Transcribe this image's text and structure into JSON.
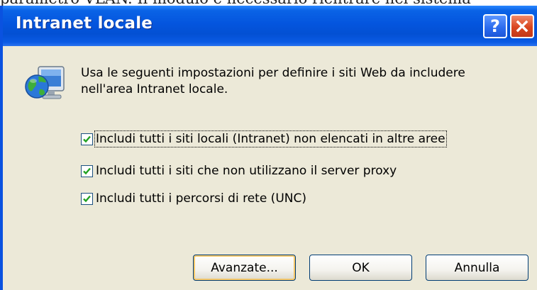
{
  "background_text": "parametro VLAN. Il modulo è necessario rientrare nel sistema",
  "dialog": {
    "title": "Intranet locale",
    "description": "Usa le seguenti impostazioni per definire i siti Web da includere nell'area Intranet locale.",
    "options": [
      {
        "label": "Includi tutti i siti locali (Intranet) non elencati in altre aree",
        "checked": true,
        "focused": true
      },
      {
        "label": "Includi tutti i siti che non utilizzano il server proxy",
        "checked": true
      },
      {
        "label": "Includi tutti i percorsi di rete (UNC)",
        "checked": true
      }
    ],
    "buttons": {
      "advanced": "Avanzate...",
      "ok": "OK",
      "cancel": "Annulla"
    }
  },
  "colors": {
    "title_bar": "#0454dc",
    "dialog_bg": "#ece9d8",
    "close_button": "#d9461f",
    "check_mark": "#21a121"
  },
  "icons": {
    "help": "help-icon",
    "close": "close-icon",
    "network": "network-globe-icon",
    "check": "check-mark-icon"
  }
}
